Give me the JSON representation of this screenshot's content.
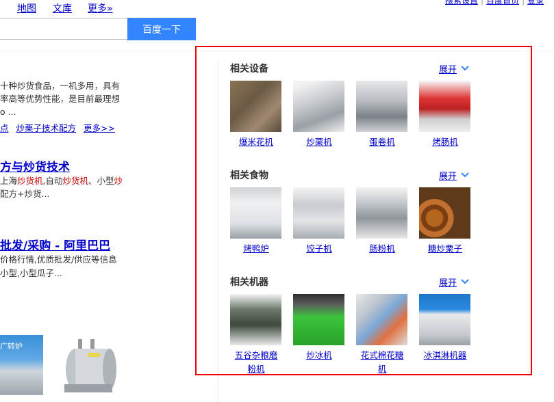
{
  "nav": {
    "links": [
      "地图",
      "文库",
      "更多»"
    ]
  },
  "top_right_links": [
    "搜索设置",
    "百度首页",
    "登录"
  ],
  "search": {
    "button_label": "百度一下"
  },
  "left_results": {
    "r1_line1": "十种炒货食品，一机多用，具有",
    "r1_line2": "率高等优势性能，是目前最理想",
    "r1_line3": "o ...",
    "r1_links": [
      "点",
      "炒栗子技术配方",
      "更多>>"
    ],
    "r2_title": "方与炒货技术",
    "r2_line1_a": "上海",
    "r2_line1_b": "炒货机",
    "r2_line1_c": ",自动",
    "r2_line1_d": "炒货机",
    "r2_line1_e": "、小型",
    "r2_line1_f": "炒",
    "r2_line2": "配方+炒货...",
    "r3_title": "批发/采购 - 阿里巴巴",
    "r3_line1": "价格行情,优质批发/供应等信息",
    "r3_line2": "小型,小型瓜子...",
    "thumb1_text": "广转炉"
  },
  "panel": {
    "sections": [
      {
        "title": "相关设备",
        "expand": "展开",
        "items": [
          "爆米花机",
          "炒栗机",
          "蛋卷机",
          "烤肠机"
        ]
      },
      {
        "title": "相关食物",
        "expand": "展开",
        "items": [
          "烤鸭炉",
          "饺子机",
          "肠粉机",
          "糖炒栗子"
        ]
      },
      {
        "title": "相关机器",
        "expand": "展开",
        "items": [
          "五谷杂粮磨\n粉机",
          "炒冰机",
          "花式棉花糖\n机",
          "冰淇淋机器"
        ]
      }
    ]
  },
  "colors": {
    "link": "#0000cc",
    "highlight": "#cc0000",
    "button": "#3385ff",
    "annotation_box": "#ee0000"
  }
}
